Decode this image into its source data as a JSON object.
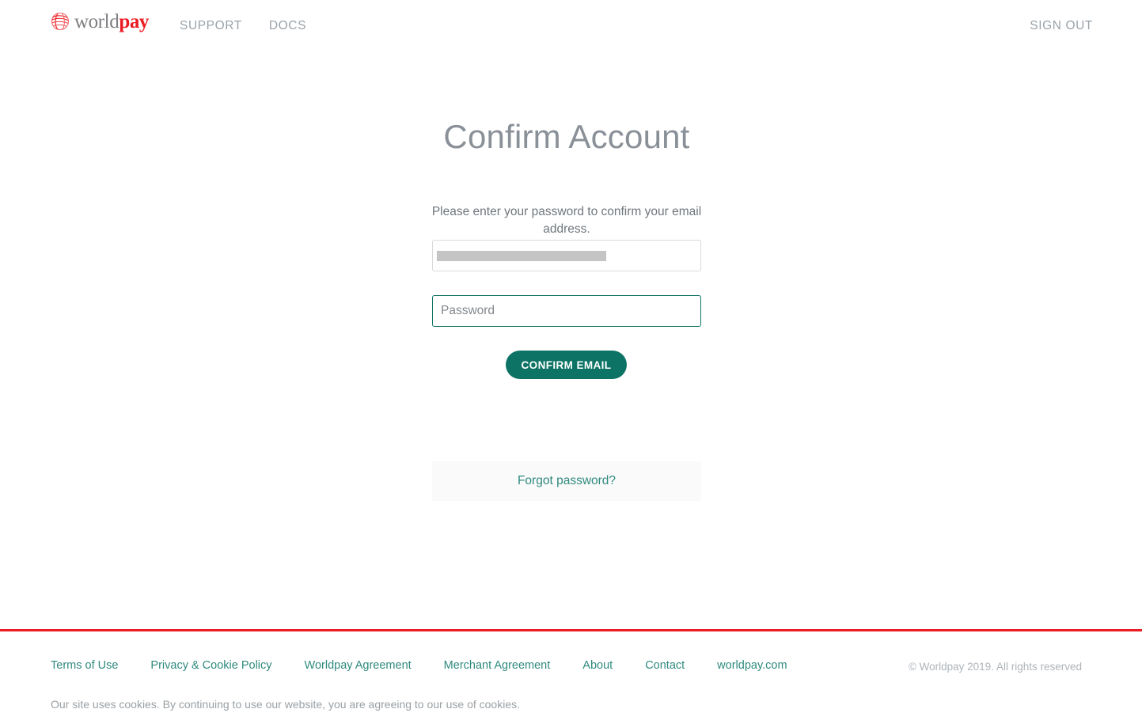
{
  "header": {
    "logo": {
      "icon": "worldpay-globe-icon",
      "text_primary": "world",
      "text_accent": "pay"
    },
    "nav": [
      {
        "label": "SUPPORT",
        "name": "nav-support"
      },
      {
        "label": "DOCS",
        "name": "nav-docs"
      }
    ],
    "sign_out_label": "SIGN OUT"
  },
  "main": {
    "title": "Confirm Account",
    "subtitle": "Please enter your password to confirm your email address.",
    "email_field": {
      "value": "",
      "placeholder": "",
      "redacted": true
    },
    "password_field": {
      "value": "",
      "placeholder": "Password"
    },
    "confirm_button_label": "CONFIRM EMAIL",
    "forgot_password_label": "Forgot password?"
  },
  "footer": {
    "links": [
      {
        "label": "Terms of Use",
        "name": "footer-link-terms-of-use"
      },
      {
        "label": "Privacy & Cookie Policy",
        "name": "footer-link-privacy-cookie-policy"
      },
      {
        "label": "Worldpay Agreement",
        "name": "footer-link-worldpay-agreement"
      },
      {
        "label": "Merchant Agreement",
        "name": "footer-link-merchant-agreement"
      },
      {
        "label": "About",
        "name": "footer-link-about"
      },
      {
        "label": "Contact",
        "name": "footer-link-contact"
      },
      {
        "label": "worldpay.com",
        "name": "footer-link-worldpay-com"
      }
    ],
    "copyright": "© Worldpay 2019. All rights reserved",
    "cookie_notice": "Our site uses cookies. By continuing to use our website, you are agreeing to our use of cookies."
  },
  "colors": {
    "brand_red": "#ec1c24",
    "teal": "#0d7365",
    "link_teal": "#2f8a7e",
    "text_gray": "#6b7176",
    "muted_gray": "#9aa2a8",
    "panel_gray": "#fafafa",
    "redaction_gray": "#c4c4c4"
  }
}
